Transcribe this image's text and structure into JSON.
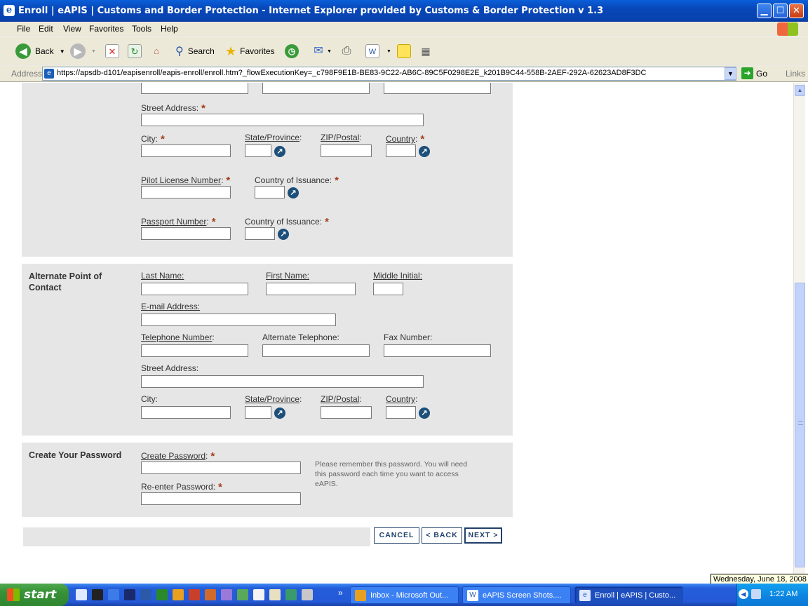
{
  "window": {
    "title": "Enroll | eAPIS | Customs and Border Protection - Internet Explorer provided by Customs & Border Protection v 1.3",
    "minimize_icon": "minimize-icon",
    "maximize_icon": "maximize-icon",
    "close_icon": "close-icon"
  },
  "menu": [
    "File",
    "Edit",
    "View",
    "Favorites",
    "Tools",
    "Help"
  ],
  "toolbar": {
    "back_label": "Back",
    "search_label": "Search",
    "favorites_label": "Favorites"
  },
  "address": {
    "label": "Address",
    "url": "https://apsdb-d101/eapisenroll/eapis-enroll/enroll.htm?_flowExecutionKey=_c798F9E1B-BE83-9C22-AB6C-89C5F0298E2E_k201B9C44-558B-2AEF-292A-62623AD8F3DC",
    "go_label": "Go",
    "links_label": "Links"
  },
  "primary_contact_partial": {
    "street_address_label": "Street Address:",
    "city_label": "City:",
    "state_label": "State/Province",
    "zip_label": "ZIP/Postal",
    "country_label": "Country",
    "pilot_license_label": "Pilot License Number",
    "country_issuance_label": "Country of Issuance:",
    "passport_label": "Passport Number",
    "passport_country_issuance_label": "Country of Issuance:"
  },
  "alternate_contact": {
    "section_title": "Alternate Point of Contact",
    "last_name_label": "Last Name:",
    "first_name_label": "First Name:",
    "middle_initial_label": "Middle Initial:",
    "email_label": "E-mail Address:",
    "telephone_label": "Telephone Number",
    "alt_telephone_label": "Alternate Telephone:",
    "fax_label": "Fax Number:",
    "street_address_label": "Street Address:",
    "city_label": "City:",
    "state_label": "State/Province",
    "zip_label": "ZIP/Postal",
    "country_label": "Country"
  },
  "password_section": {
    "section_title": "Create Your Password",
    "create_label": "Create Password",
    "reenter_label": "Re-enter Password:",
    "note": "Please remember this password. You will need this password each time you want to access eAPIS."
  },
  "buttons": {
    "cancel": "CANCEL",
    "back": "< BACK",
    "next": "NEXT >"
  },
  "taskbar": {
    "start_label": "start",
    "tasks": [
      "Inbox - Microsoft Out...",
      "eAPIS Screen Shots....",
      "Enroll | eAPIS | Custo..."
    ],
    "clock": "1:22 AM",
    "date_tooltip": "Wednesday, June 18, 2008"
  }
}
